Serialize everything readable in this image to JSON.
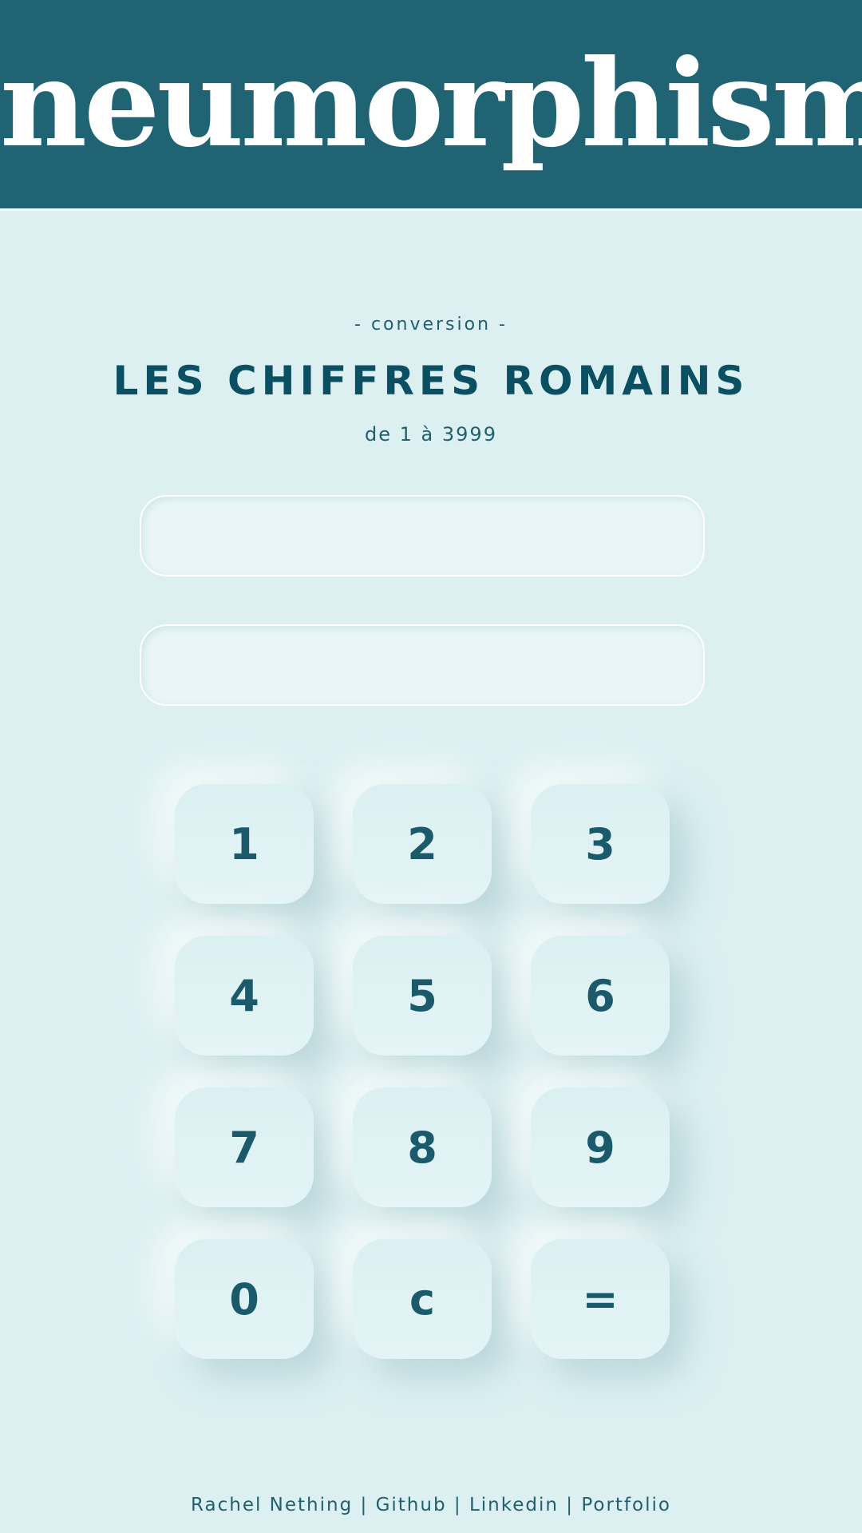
{
  "header": {
    "brand": "neumorphism"
  },
  "intro": {
    "kicker": "- conversion -",
    "title": "LES CHIFFRES ROMAINS",
    "subtitle": "de 1 à 3999"
  },
  "inputs": {
    "arabic_value": "",
    "roman_value": ""
  },
  "keypad": {
    "keys": [
      "1",
      "2",
      "3",
      "4",
      "5",
      "6",
      "7",
      "8",
      "9",
      "0",
      "c",
      "="
    ]
  },
  "footer": {
    "name": "Rachel Nething",
    "separator": "|",
    "github": "Github",
    "linkedin": "Linkedin",
    "portfolio": "Portfolio"
  },
  "colors": {
    "header_bg": "#206474",
    "page_bg": "#dcf0f2",
    "text_primary": "#0b4f62"
  }
}
